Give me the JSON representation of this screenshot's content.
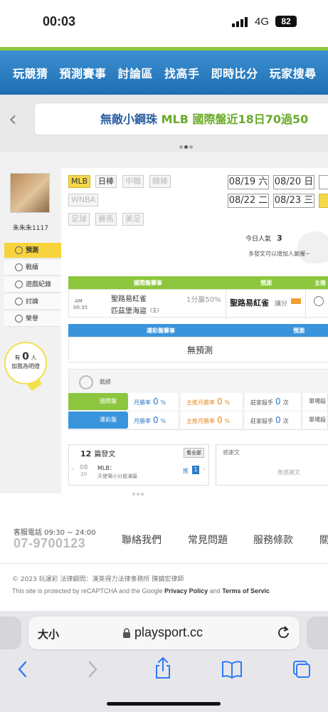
{
  "status_bar": {
    "time": "00:03",
    "network": "4G",
    "battery": "82"
  },
  "nav": {
    "items": [
      "玩競猜",
      "預測賽事",
      "討論區",
      "找高手",
      "即時比分",
      "玩家搜尋"
    ]
  },
  "banner": {
    "part1": "無敵小鋼珠",
    "part2": "MLB",
    "part3": "國際盤近18日70過50"
  },
  "profile": {
    "username": "朱朱朱1117",
    "menu": [
      "預測",
      "戰績",
      "遊戲紀錄",
      "討論",
      "榮譽"
    ],
    "bulb_prefix": "有",
    "bulb_count": "0",
    "bulb_suffix": "人",
    "bulb_line2": "加我為明燈"
  },
  "sports_tags": [
    "MLB",
    "日棒",
    "中職",
    "韓棒",
    "WNBA",
    "足球",
    "賽馬",
    "美足"
  ],
  "dates": [
    {
      "date": "08/19",
      "day": "六"
    },
    {
      "date": "08/20",
      "day": "日"
    },
    {
      "date": "08/22",
      "day": "二"
    },
    {
      "date": "08/23",
      "day": "三"
    }
  ],
  "popularity": {
    "label": "今日人氣",
    "value": "3",
    "note": "多發文可以增加人氣喔~"
  },
  "intl_table": {
    "headers": [
      "國際盤賽事",
      "預測",
      "主推"
    ],
    "row": {
      "ampm": "AM",
      "time": "00:35",
      "team1": "聖路易紅雀",
      "team2": "匹茲堡海盜",
      "team2_suffix": "(主)",
      "spread": "1分贏50%",
      "pick": "聖路易紅雀",
      "pick_type": "讓分"
    }
  },
  "lottery_table": {
    "headers": [
      "運彩盤賽事",
      "預測"
    ],
    "empty": "無預測"
  },
  "record": {
    "title": "戰績",
    "rows": [
      {
        "label": "國際盤",
        "win_label": "月勝率",
        "win": "0",
        "main_label": "主推月勝率",
        "main": "0",
        "killer_label": "莊家殺手",
        "killer": "0",
        "killer_unit": "次",
        "single_label": "單場殺"
      },
      {
        "label": "運彩盤",
        "win_label": "月勝率",
        "win": "0",
        "main_label": "主推月勝率",
        "main": "0",
        "killer_label": "莊家殺手",
        "killer": "0",
        "killer_unit": "次",
        "single_label": "單場殺"
      }
    ],
    "pct": "%"
  },
  "posts": {
    "count": "12",
    "label": "篇發文",
    "view_all": "看全部",
    "item": {
      "month": "08",
      "day": "20",
      "title": "MLB：",
      "subtitle": "天使場小分搶滿篇",
      "push_label": "推",
      "push_count": "1"
    }
  },
  "thanks": {
    "title": "感謝文",
    "empty": "無感謝文"
  },
  "footer": {
    "service_label": "客服電話 09:30 ~ 24:00",
    "phone": "07-9700123",
    "links": [
      "聯絡我們",
      "常見問題",
      "服務條款",
      "關"
    ],
    "copyright": "© 2023 玩運彩  法律顧問：漢英得力法律事務所  陳鎮宏律師",
    "recaptcha_pre": "This site is protected by reCAPTCHA and the Google ",
    "privacy": "Privacy Policy",
    "and": " and ",
    "terms": "Terms of Servic"
  },
  "browser": {
    "text_size": "大小",
    "url": "playsport.cc"
  },
  "colors": {
    "nav_blue": "#1f6fb4",
    "green": "#8cc63e",
    "lottery_blue": "#3a94dc",
    "highlight_yellow": "#f5d84a"
  }
}
